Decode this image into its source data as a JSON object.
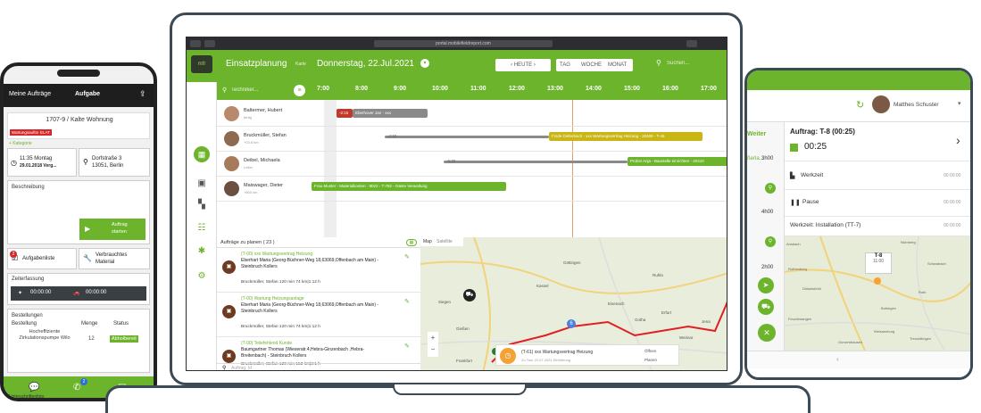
{
  "laptop": {
    "url": "portal.mobilefieldreport.com",
    "title": "Einsatzplanung",
    "karte_label": "Karte",
    "date": "Donnerstag, 22.Jul.2021",
    "today": "HEUTE",
    "view_day": "TAG",
    "view_week": "WOCHE",
    "view_month": "MONAT",
    "search_placeholder": "Suchen...",
    "tech_placeholder": "Techniker...",
    "hours": [
      "7:00",
      "8:00",
      "9:00",
      "10:00",
      "11:00",
      "12:00",
      "13:00",
      "14:00",
      "15:00",
      "16:00",
      "17:00"
    ],
    "technicians": [
      {
        "name": "Baltermer, Hubert",
        "sub": "fertig"
      },
      {
        "name": "Bruckmüller, Stefan",
        "sub": "+03.6 km"
      },
      {
        "name": "Deibel, Michaela",
        "sub": "Leiter"
      },
      {
        "name": "Maiswager, Dieter",
        "sub": "+800 km"
      }
    ],
    "bars": [
      {
        "label": "-2:15",
        "color": "#c0392b"
      },
      {
        "label": "Eberhover Jan - xxx",
        "color": "#8a8a8a"
      },
      {
        "label": "-4:15",
        "color": "#8a8a8a"
      },
      {
        "label": "Finde Dieferbach - xxx Wartungsvertrag Heizung - 20406 - T-45",
        "color": "#c9b514"
      },
      {
        "label": "-5:30",
        "color": "#8a8a8a"
      },
      {
        "label": "Probst Anja - Baustelle einrichten - 20410",
        "color": "#6cb42c"
      },
      {
        "label": "Frau Muster - Materialkosten - 8022 - T-782 - Gäste Verwaltung",
        "color": "#6cb42c"
      }
    ],
    "orders_header": "Aufträge zu planen ( 23 )",
    "orders": [
      {
        "title": "(T-00) xxx Wartungsvertrag Heizung",
        "text": "Eberhart Maria (Georg-Büchner-Weg 18,63069,Offenbach am Main) - Steinbruch Kollers",
        "meta": "Bruckmüller, Stefan  120 min  74 km|1:12 h"
      },
      {
        "title": "(T-00) Wartung Heizungsanlage",
        "text": "Eberhart Maria (Georg-Büchner-Weg 18,63069,Offenbach am Main) - Steinbruch Kollers",
        "meta": "Bruckmüller, Stefan  120 min  74 km|1:12 h"
      },
      {
        "title": "(T-00) Teilefehlend Kunde",
        "text": "Baumgartner Thomas (Wieseratr.4,Hebra-Ginzenbach ,Hebra-Breitenbach) - Steinbruch Kollers",
        "meta": "Bruckmüller, Stefan  120 min  153 km|2:1 h"
      }
    ],
    "order_search": "Auftrag, Id",
    "map_tab1": "Map",
    "map_tab2": "Satellite",
    "map_popup_title": "(T-61) xxx Wartungsvertrag Heizung",
    "map_popup_sub": "Zu Tour 22.07.2021 Einführung",
    "map_popup_btn1": "Öffnen",
    "map_popup_btn2": "Planen",
    "map_labels": [
      "Göttingen",
      "Kassel",
      "Eisenach",
      "Erfurt",
      "Gießen",
      "Frankfurt",
      "Fulda",
      "Jena",
      "Weimar",
      "Gotha",
      "Siegen",
      "Ruhla"
    ]
  },
  "phone": {
    "back": "Meine Aufträge",
    "title": "Aufgabe",
    "order_id": "1707-9 / Kalte Wohnung",
    "tag1": "Wartungsauftrag",
    "tag2": "ELAT",
    "category": "+ Kategorie",
    "date_line1": "11:35 Montag",
    "date_line2": "29.01.2018 Verg...",
    "addr_line1": "Dorfstraße 3",
    "addr_line2": "13051, Berlin",
    "desc_label": "Beschreibung",
    "start_btn1": "Auftrag",
    "start_btn2": "starten",
    "task_list": "Aufgabenliste",
    "material1": "Verbrauchtes",
    "material2": "Material",
    "time_label": "Zeiterfassung",
    "time1": "00:00:00",
    "time2": "00:00:00",
    "orders_label": "Bestellungen",
    "col_order": "Bestellung",
    "col_qty": "Menge",
    "col_status": "Status",
    "item_name": "Hocheffiziente Zirkulationspumpe Wilo",
    "item_qty": "12",
    "item_status": "Abholbereit",
    "badge": "2",
    "bottom_label": "Unterschriftenfoto"
  },
  "tablet": {
    "user": "Matthes Schuster",
    "weiter": "Weiter",
    "left_times": [
      "3h00",
      "4h00",
      "2h00"
    ],
    "left_label": "ßerla...",
    "order_title": "Auftrag: T-8 (00:25)",
    "timer": "00:25",
    "werkzeit": "Werkzeit",
    "pause": "Pause",
    "werkzeit_install": "Werkzeit: Installation (TT-7)",
    "zero": "00:00:00",
    "map_pin": "T-8",
    "map_pin_time": "11:00",
    "map_labels": [
      "Ansbach",
      "Nürnberg",
      "Schwabach",
      "Roth",
      "Rothenburg",
      "Dinkelsbühl",
      "Feuchtwangen",
      "Weissenburg",
      "Treuchtlingen",
      "Gunzenhausen",
      "Bobingen"
    ]
  }
}
